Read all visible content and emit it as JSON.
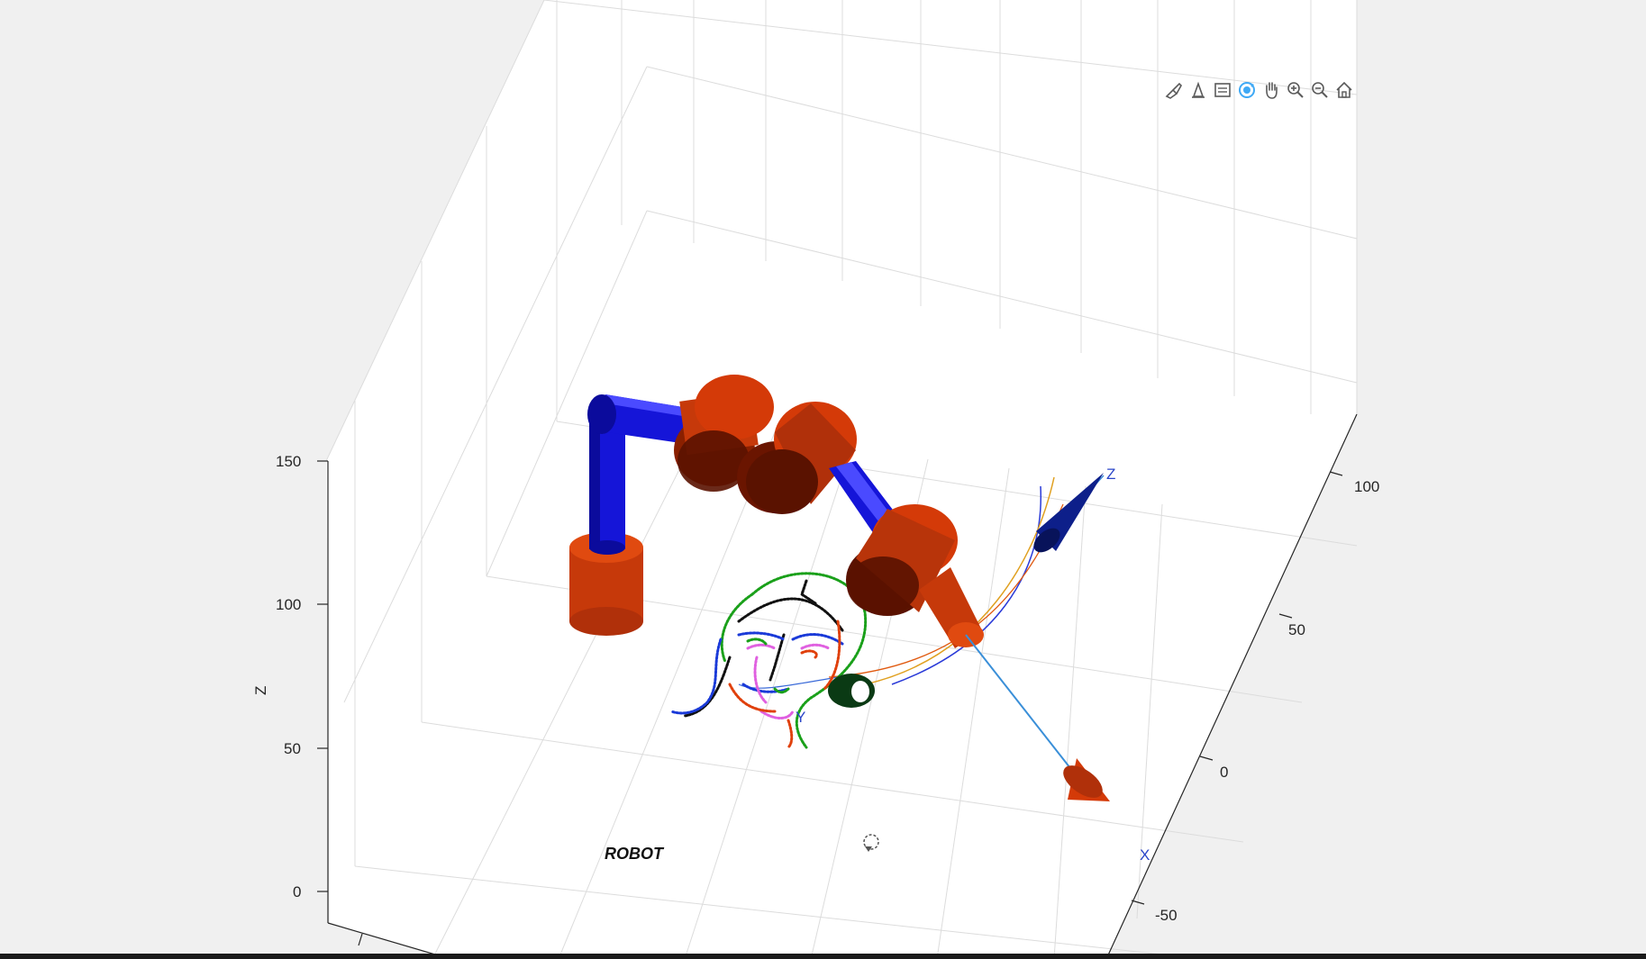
{
  "toolbar": {
    "items": [
      {
        "name": "brush-icon",
        "label": "Brush"
      },
      {
        "name": "data-tip-icon",
        "label": "Data Tips"
      },
      {
        "name": "restore-view-icon",
        "label": "Restore View"
      },
      {
        "name": "rotate-3d-icon",
        "label": "Rotate 3D",
        "active": true
      },
      {
        "name": "pan-icon",
        "label": "Pan"
      },
      {
        "name": "zoom-in-icon",
        "label": "Zoom In"
      },
      {
        "name": "zoom-out-icon",
        "label": "Zoom Out"
      },
      {
        "name": "home-icon",
        "label": "Restore View (Home)"
      }
    ],
    "active_color": "#3fa9f5",
    "icon_color": "#5a5a5a"
  },
  "axes": {
    "z_label": "Z",
    "z_ticks": [
      "150",
      "100",
      "50",
      "0"
    ],
    "y_ticks": [
      "100",
      "50",
      "0",
      "-50"
    ]
  },
  "scene": {
    "title": "ROBOT",
    "frame_labels": {
      "z": "Z",
      "y": "Y",
      "x": "X"
    },
    "colors": {
      "link": "#1515d8",
      "joint": "#d43a08",
      "joint_dark": "#5a1200",
      "frame_z_cone": "#0d1f8a",
      "frame_x_cone": "#d43a08",
      "frame_y_cone": "#0a3a14",
      "axis_line": "#3a8fd8",
      "grid": "#dedede",
      "face_green": "#1aa01a",
      "face_black": "#111111",
      "face_blue": "#1a3ad8",
      "face_red": "#e0400c",
      "face_pink": "#e060e0"
    }
  }
}
